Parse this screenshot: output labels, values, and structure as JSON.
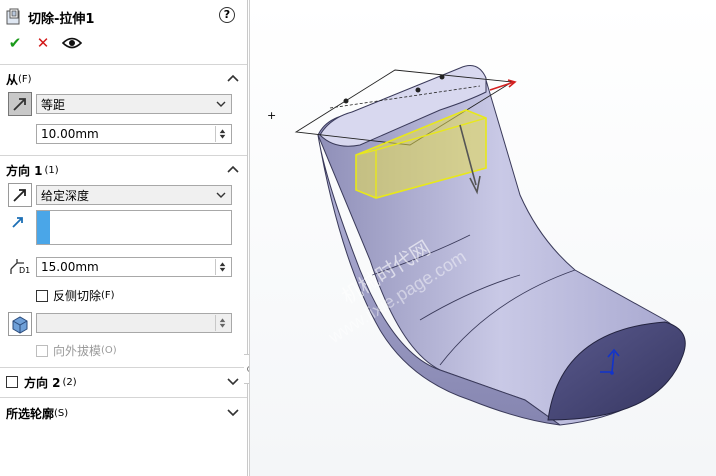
{
  "feature": {
    "title": "切除-拉伸1",
    "help_icon": "help-icon",
    "help_label": "?"
  },
  "actions": {
    "ok_icon": "checkmark-icon",
    "ok_label": "✔",
    "cancel_icon": "x-icon",
    "cancel_label": "✕",
    "preview_icon": "eye-icon"
  },
  "from_section": {
    "label": "从",
    "shortcut": "(F)",
    "start_condition": "等距",
    "offset_value": "10.00mm"
  },
  "direction1": {
    "label": "方向 1",
    "shortcut": "(1)",
    "end_condition": "给定深度",
    "depth_value": "15.00mm",
    "depth_icon_label": "D1",
    "flip_side_label": "反侧切除",
    "flip_side_shortcut": "(F)",
    "flip_side_checked": false,
    "draft_value": "",
    "draft_outward_label": "向外拔模",
    "draft_outward_shortcut": "(O)",
    "draft_outward_checked": false
  },
  "direction2": {
    "label": "方向 2",
    "shortcut": "(2)",
    "checked": false
  },
  "selected_contours": {
    "label": "所选轮廓",
    "shortcut": "(S)"
  },
  "viewport": {
    "watermark_cn": "机械时代网",
    "watermark_en": "www.jixie.page.com"
  }
}
